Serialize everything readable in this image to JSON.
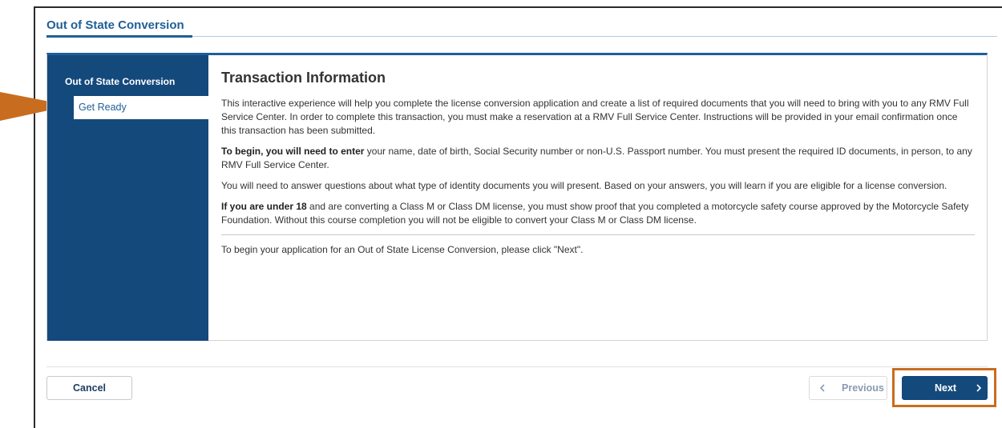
{
  "header": {
    "title": "Out of State Conversion"
  },
  "sidebar": {
    "heading": "Out of State Conversion",
    "items": [
      {
        "label": "Get Ready",
        "active": true
      }
    ]
  },
  "main": {
    "heading": "Transaction Information",
    "p1": "This interactive experience will help you complete the license conversion application and create a list of required documents that you will need to bring with you to any RMV Full Service Center. In order to complete this transaction, you must make a reservation at a RMV Full Service Center. Instructions will be provided in your email confirmation once this transaction has been submitted.",
    "p2_bold": "To begin, you will need to enter",
    "p2_rest": " your name, date of birth, Social Security number or non-U.S. Passport number. You must present the required ID documents, in person, to any RMV Full Service Center.",
    "p3": "You will need to answer questions about what type of identity documents you will present. Based on your answers, you will learn if you are eligible for a license conversion.",
    "p4_bold": "If you are under 18",
    "p4_rest": " and are converting a Class M or Class DM license, you must show proof that you completed a motorcycle safety course approved by the Motorcycle Safety Foundation. Without this course completion you will not be eligible to convert your Class M or Class DM license.",
    "p5": "To begin your application for an Out of State License Conversion, please click \"Next\"."
  },
  "footer": {
    "cancel_label": "Cancel",
    "previous_label": "Previous",
    "previous_icon": "chevron-left-icon",
    "next_label": "Next",
    "next_icon": "chevron-right-icon"
  },
  "colors": {
    "brand_blue": "#14497c",
    "title_blue": "#1f5f98",
    "annotation_orange": "#c86d20"
  }
}
